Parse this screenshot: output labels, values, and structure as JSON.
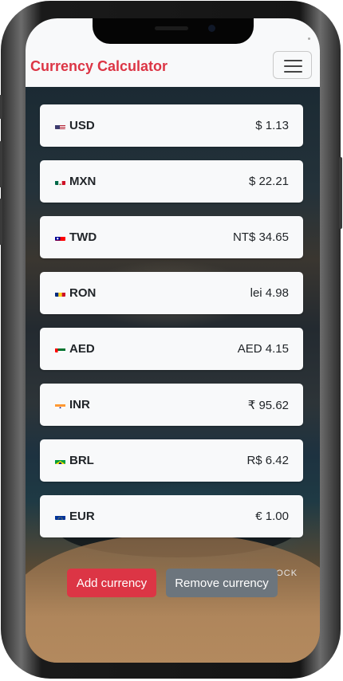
{
  "navbar": {
    "brand": "Currency Calculator"
  },
  "currencies": [
    {
      "code": "USD",
      "value": "$ 1.13",
      "flag": "us-flag-icon"
    },
    {
      "code": "MXN",
      "value": "$ 22.21",
      "flag": "mx-flag-icon"
    },
    {
      "code": "TWD",
      "value": "NT$ 34.65",
      "flag": "tw-flag-icon"
    },
    {
      "code": "RON",
      "value": "lei 4.98",
      "flag": "ro-flag-icon"
    },
    {
      "code": "AED",
      "value": "AED 4.15",
      "flag": "ae-flag-icon"
    },
    {
      "code": "INR",
      "value": "₹ 95.62",
      "flag": "in-flag-icon"
    },
    {
      "code": "BRL",
      "value": "R$ 6.42",
      "flag": "br-flag-icon"
    },
    {
      "code": "EUR",
      "value": "€ 1.00",
      "flag": "eu-flag-icon"
    }
  ],
  "actions": {
    "add_label": "Add currency",
    "remove_label": "Remove currency"
  },
  "background": {
    "sign_text": "K STOCK"
  },
  "colors": {
    "brand": "#dc3545",
    "add": "#dc3545",
    "remove": "#6c757d",
    "card": "#f8f9fa"
  }
}
